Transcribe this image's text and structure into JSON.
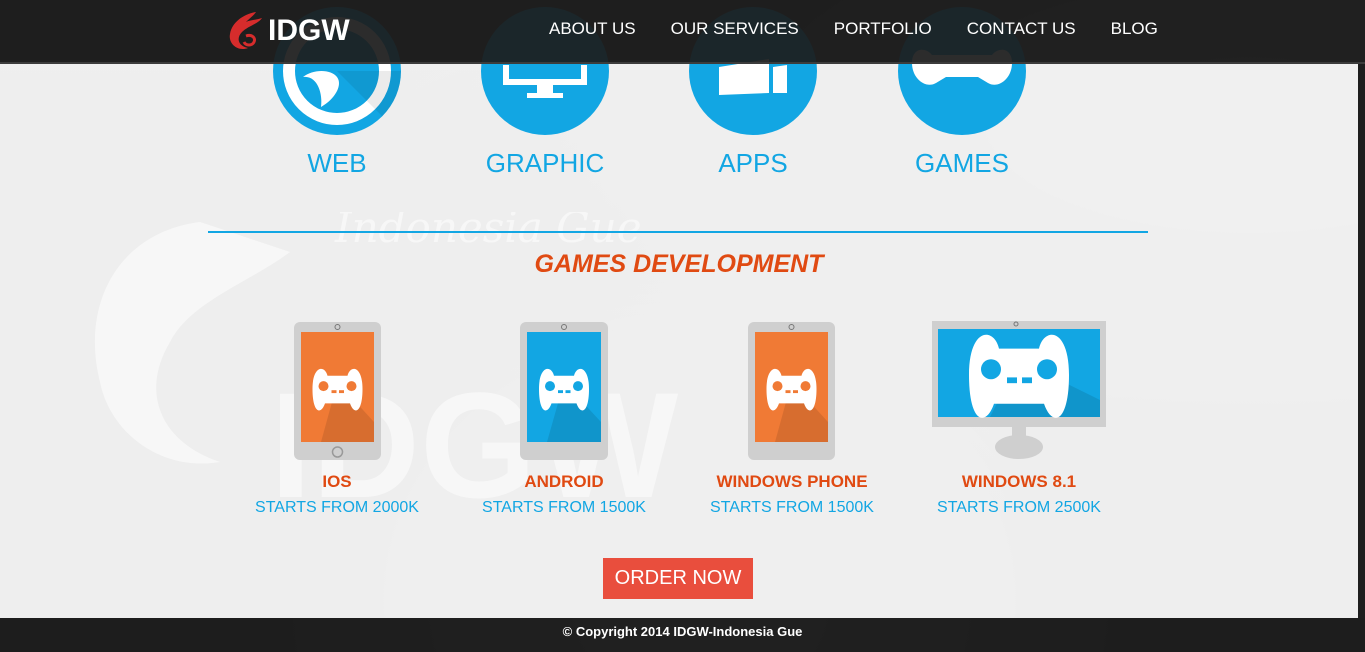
{
  "brand": {
    "name": "IDGW"
  },
  "nav": {
    "items": [
      "ABOUT US",
      "OUR SERVICES",
      "PORTFOLIO",
      "CONTACT US",
      "BLOG"
    ]
  },
  "services": [
    {
      "label": "WEB",
      "icon": "globe-icon"
    },
    {
      "label": "GRAPHIC",
      "icon": "monitor-icon"
    },
    {
      "label": "APPS",
      "icon": "windows-icon"
    },
    {
      "label": "GAMES",
      "icon": "gamepad-icon"
    }
  ],
  "section": {
    "title": "GAMES DEVELOPMENT"
  },
  "platforms": [
    {
      "name": "IOS",
      "price": "STARTS FROM 2000K",
      "screen_color": "#f07a35"
    },
    {
      "name": "ANDROID",
      "price": "STARTS FROM 1500K",
      "screen_color": "#12a6e3"
    },
    {
      "name": "WINDOWS PHONE",
      "price": "STARTS FROM 1500K",
      "screen_color": "#f07a35"
    },
    {
      "name": "WINDOWS 8.1",
      "price": "STARTS FROM 2500K",
      "screen_color": "#12a6e3"
    }
  ],
  "watermark": {
    "text": "Indonesia Gue",
    "brand": "IDGW"
  },
  "cta": {
    "label": "ORDER NOW"
  },
  "footer": {
    "copyright": "© Copyright 2014 IDGW-Indonesia Gue"
  },
  "colors": {
    "accent_blue": "#12a6e3",
    "accent_orange": "#e04a12",
    "button_red": "#e94e3d",
    "nav_bg": "#1c1c1c"
  }
}
